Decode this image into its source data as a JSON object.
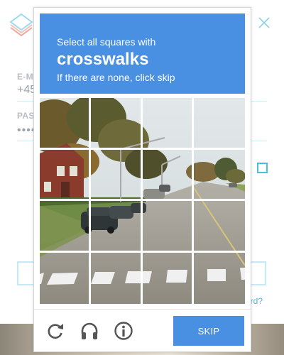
{
  "background_page": {
    "email_label": "E-MA",
    "email_value": "+45",
    "password_label": "PASS",
    "password_value": "••••",
    "forgot_text": "ord?"
  },
  "captcha": {
    "instruction": "Select all squares with",
    "target": "crosswalks",
    "hint": "If there are none, click skip",
    "skip_label": "SKIP",
    "grid_rows": 4,
    "grid_cols": 4,
    "accent_color": "#4a90e2"
  },
  "icons": [
    "refresh-icon",
    "headphones-icon",
    "info-icon",
    "close-icon",
    "logo-icon"
  ]
}
